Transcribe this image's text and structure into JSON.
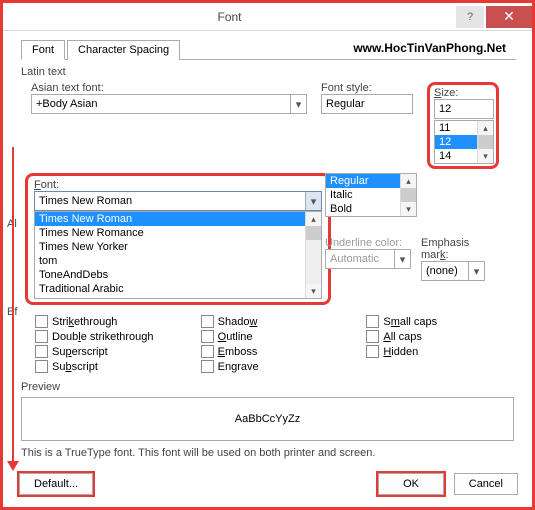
{
  "window": {
    "title": "Font"
  },
  "watermark": "www.HocTinVanPhong.Net",
  "tabs": {
    "font": "Font",
    "spacing": "Character Spacing"
  },
  "labels": {
    "latin": "Latin text",
    "asian_font": "Asian text font:",
    "font": "Font:",
    "font_style": "Font style:",
    "size": "Size:",
    "underline_color": "Underline color:",
    "emphasis": "Emphasis mark:",
    "all_text": "All text",
    "effects": "Effects",
    "strike": "Strikethrough",
    "dstrike": "Double strikethrough",
    "sup": "Superscript",
    "sub": "Subscript",
    "shadow": "Shadow",
    "outline": "Outline",
    "emboss": "Emboss",
    "engrave": "Engrave",
    "smallcaps": "Small caps",
    "allcaps": "All caps",
    "hidden": "Hidden",
    "preview": "Preview",
    "note": "This is a TrueType font. This font will be used on both printer and screen."
  },
  "values": {
    "asian_font": "+Body Asian",
    "font": "Times New Roman",
    "font_style": "Regular",
    "size": "12",
    "underline_color": "Automatic",
    "emphasis": "(none)",
    "preview_text": "AaBbCcYyZz"
  },
  "font_list": [
    "Times New Roman",
    "Times New Romance",
    "Times New Yorker",
    "tom",
    "ToneAndDebs",
    "Traditional Arabic"
  ],
  "style_list": [
    "Regular",
    "Italic",
    "Bold"
  ],
  "size_list": [
    "11",
    "12",
    "14"
  ],
  "buttons": {
    "default": "Default...",
    "ok": "OK",
    "cancel": "Cancel"
  }
}
